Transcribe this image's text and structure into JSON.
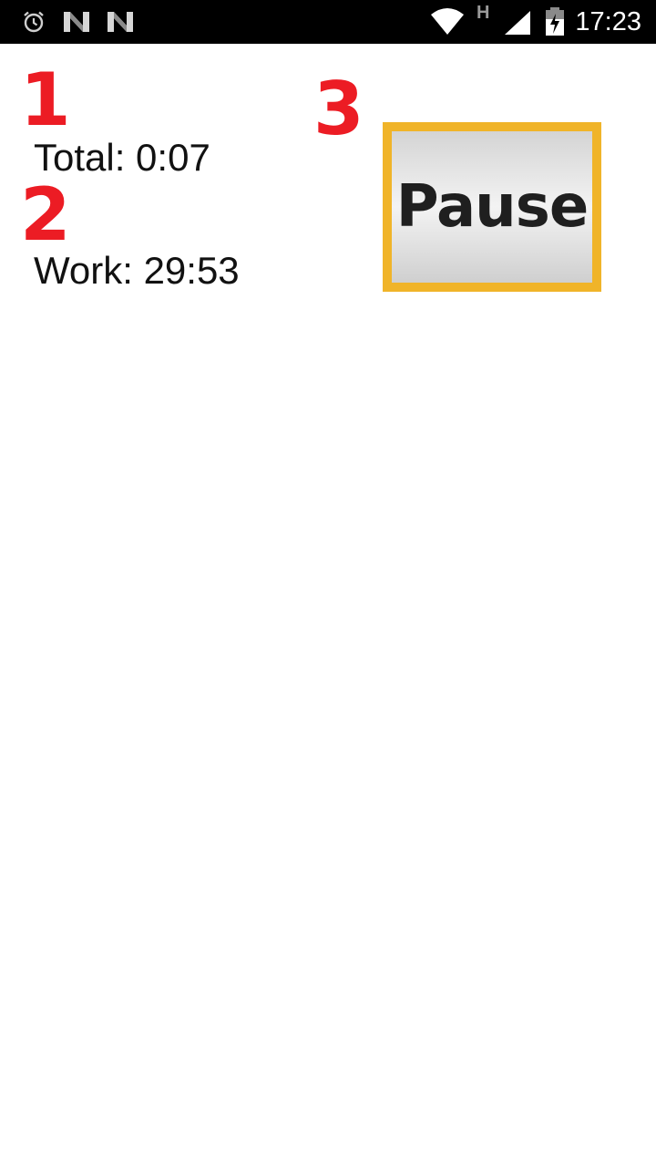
{
  "status_bar": {
    "time": "17:23",
    "network_type": "H",
    "icons": [
      "alarm-icon",
      "notification-n-icon",
      "notification-n-icon",
      "wifi-icon",
      "cell-signal-icon",
      "battery-charging-icon"
    ]
  },
  "markers": {
    "one": "1",
    "two": "2",
    "three": "3"
  },
  "timers": {
    "total": "Total: 0:07",
    "work": "Work: 29:53"
  },
  "pause_button": {
    "label": "Pause"
  },
  "colors": {
    "marker": "#ec1c24",
    "button_border": "#f0b429",
    "status_bar_bg": "#000000"
  }
}
